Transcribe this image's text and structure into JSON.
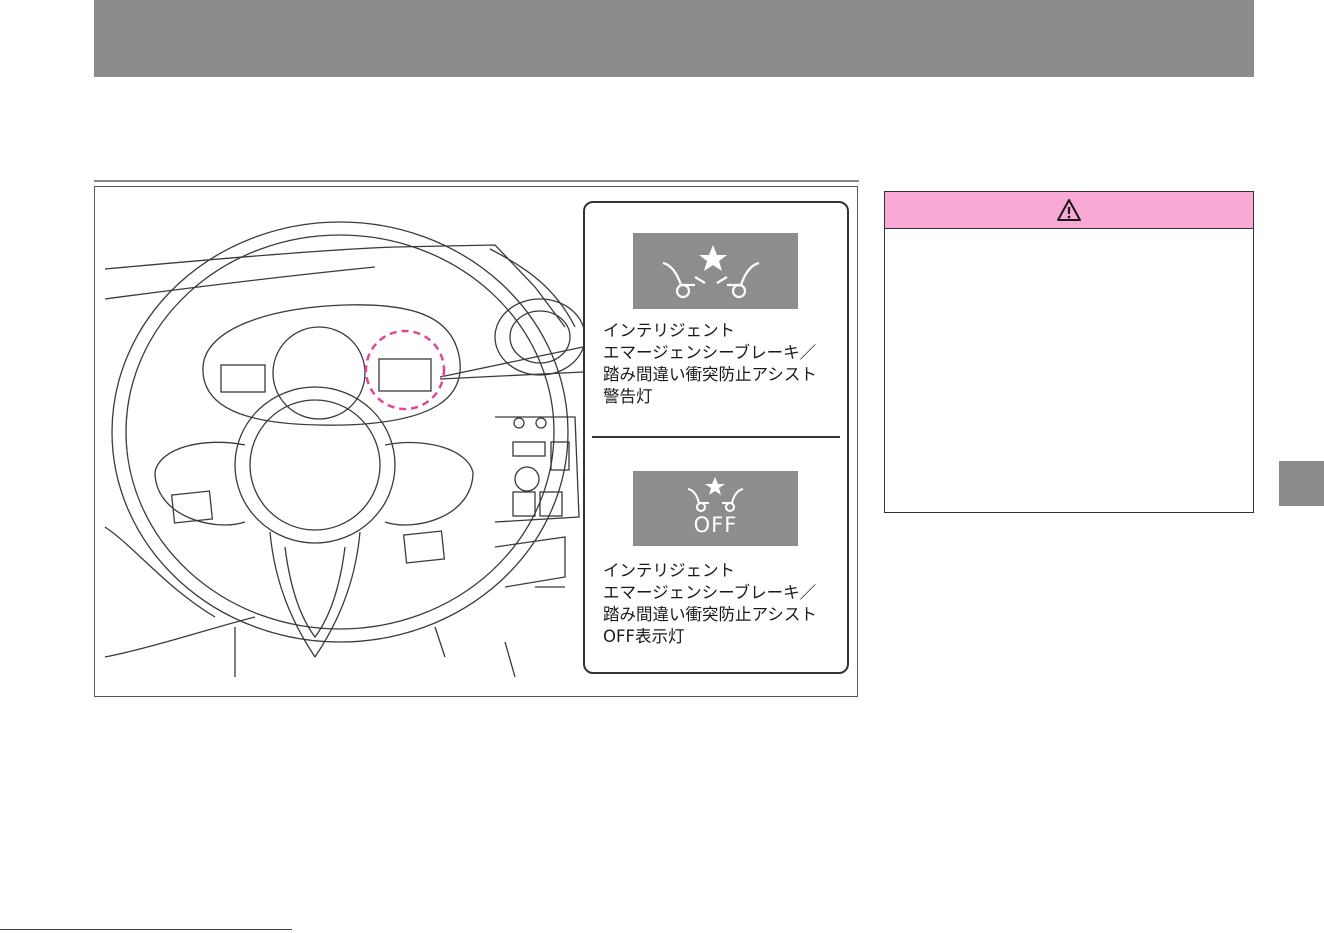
{
  "colors": {
    "header_bar": "#8c8b8c",
    "warning_header": "#f8a9d6",
    "indicator_bg": "#8d8d8d",
    "highlight_circle": "#e0478f",
    "side_tab": "#8a8a8a"
  },
  "figure": {
    "callout_warning": {
      "icon": "collision-warning-icon",
      "caption_lines": [
        "インテリジェント",
        "エマージェンシーブレーキ／",
        "踏み間違い衝突防止アシスト",
        "警告灯"
      ]
    },
    "callout_off": {
      "icon": "collision-off-icon",
      "off_text": "OFF",
      "caption_lines": [
        "インテリジェント",
        "エマージェンシーブレーキ／",
        "踏み間違い衝突防止アシスト",
        "OFF表示灯"
      ]
    }
  },
  "warning_panel": {
    "icon": "warning-triangle-icon"
  }
}
